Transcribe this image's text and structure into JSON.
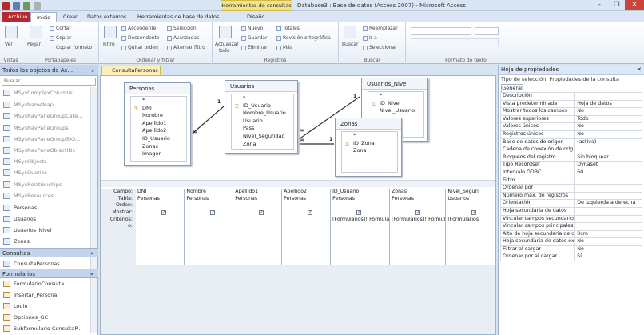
{
  "window": {
    "context_tab": "Herramientas de consultas",
    "title": "Database3 : Base de datos (Access 2007) - Microsoft Access"
  },
  "ribbon_tabs": [
    "Archivo",
    "Inicio",
    "Crear",
    "Datos externos",
    "Herramientas de base de datos",
    "Diseño"
  ],
  "ribbon": {
    "vistas": {
      "label": "Vistas",
      "ver": "Ver"
    },
    "portapapeles": {
      "label": "Portapapeles",
      "pegar": "Pegar",
      "cortar": "Cortar",
      "copiar": "Copiar",
      "copiar_formato": "Copiar formato"
    },
    "ordenar": {
      "label": "Ordenar y filtrar",
      "filtro": "Filtro",
      "ascendente": "Ascendente",
      "descendente": "Descendente",
      "quitar_orden": "Quitar orden",
      "seleccion": "Selección",
      "avanzadas": "Avanzadas",
      "alternar_filtro": "Alternar filtro"
    },
    "registros": {
      "label": "Registros",
      "actualizar": "Actualizar",
      "todo": "todo",
      "nuevo": "Nuevo",
      "guardar": "Guardar",
      "eliminar": "Eliminar",
      "totales": "Totales",
      "revision": "Revisión ortográfica",
      "mas": "Más"
    },
    "buscar": {
      "label": "Buscar",
      "buscar": "Buscar",
      "reemplazar": "Reemplazar",
      "ir_a": "Ir a",
      "seleccionar": "Seleccionar"
    },
    "formato": {
      "label": "Formato de texto"
    }
  },
  "nav": {
    "header": "Todos los objetos de Ac...",
    "search_placeholder": "Buscar...",
    "system_tables": [
      "MSysComplexColumns",
      "MSysNameMap",
      "MSysNavPaneGroupCate...",
      "MSysNavPaneGroups",
      "MSysNavPaneGroupToO...",
      "MSysNavPaneObjectIDs",
      "MSysObjects",
      "MSysQueries",
      "MSysRelationships",
      "MSysResources"
    ],
    "tables": [
      "Personas",
      "Usuarios",
      "Usuarios_Nivel",
      "Zonas"
    ],
    "consultas_label": "Consultas",
    "consultas": [
      "ConsultaPersonas"
    ],
    "formularios_label": "Formularios",
    "formularios": [
      "FormularioConsulta",
      "Insertar_Persona",
      "Login",
      "Opciones_GC",
      "Subformulario ConsultaP..."
    ]
  },
  "doc_tab": "ConsultaPersonas",
  "tables": {
    "personas": {
      "title": "Personas",
      "fields": [
        "*",
        "DNI",
        "Nombre",
        "Apellido1",
        "Apellido2",
        "ID_Usuario",
        "Zonas",
        "Imagen"
      ]
    },
    "usuarios": {
      "title": "Usuarios",
      "fields": [
        "*",
        "ID_Usuario",
        "Nombre_Usuario",
        "Usuario",
        "Pass",
        "Nivel_Seguridad",
        "Zona"
      ]
    },
    "usuarios_nivel": {
      "title": "Usuarios_Nivel",
      "fields": [
        "*",
        "ID_Nivel",
        "Nivel_Usuario"
      ]
    },
    "zonas": {
      "title": "Zonas",
      "fields": [
        "*",
        "ID_Zona",
        "Zona"
      ]
    }
  },
  "relations": {
    "one": "1",
    "many": "∞"
  },
  "grid": {
    "row_labels": [
      "Campo:",
      "Tabla:",
      "Orden:",
      "Mostrar:",
      "Criterios:",
      "o:"
    ],
    "columns": [
      {
        "campo": "DNI",
        "tabla": "Personas",
        "mostrar": true,
        "criterios": ""
      },
      {
        "campo": "Nombre",
        "tabla": "Personas",
        "mostrar": true,
        "criterios": ""
      },
      {
        "campo": "Apellido1",
        "tabla": "Personas",
        "mostrar": true,
        "criterios": ""
      },
      {
        "campo": "Apellido2",
        "tabla": "Personas",
        "mostrar": true,
        "criterios": ""
      },
      {
        "campo": "ID_Usuario",
        "tabla": "Personas",
        "mostrar": true,
        "criterios": "[Formularios]![Formula"
      },
      {
        "campo": "Zonas",
        "tabla": "Personas",
        "mostrar": true,
        "criterios": "[Formularios]![Formul"
      },
      {
        "campo": "Nivel_Seguri",
        "tabla": "Usuarios",
        "mostrar": true,
        "criterios": "[Formularios"
      }
    ]
  },
  "props": {
    "header": "Hoja de propiedades",
    "selection_type": "Tipo de selección:  Propiedades de la consulta",
    "tab": "General",
    "rows": [
      [
        "Descripción",
        ""
      ],
      [
        "Vista predeterminada",
        "Hoja de datos"
      ],
      [
        "Mostrar todos los campos",
        "No"
      ],
      [
        "Valores superiores",
        "Todo"
      ],
      [
        "Valores únicos",
        "No"
      ],
      [
        "Registros únicos",
        "No"
      ],
      [
        "Base de datos de origen",
        "(activa)"
      ],
      [
        "Cadena de conexión de orig",
        ""
      ],
      [
        "Bloqueos del registro",
        "Sin bloquear"
      ],
      [
        "Tipo Recordset",
        "Dynaset"
      ],
      [
        "Intervalo ODBC",
        "60"
      ],
      [
        "Filtro",
        ""
      ],
      [
        "Ordenar por",
        ""
      ],
      [
        "Número máx. de registros",
        ""
      ],
      [
        "Orientación",
        "De izquierda a derecha"
      ],
      [
        "Hoja secundaria de datos",
        ""
      ],
      [
        "Vincular campos secundario",
        ""
      ],
      [
        "Vincular campos principales",
        ""
      ],
      [
        "Alto de hoja secundaria de d",
        "0cm"
      ],
      [
        "Hoja secundaria de datos ex",
        "No"
      ],
      [
        "Filtrar al cargar",
        "No"
      ],
      [
        "Ordenar por al cargar",
        "Sí"
      ]
    ]
  }
}
